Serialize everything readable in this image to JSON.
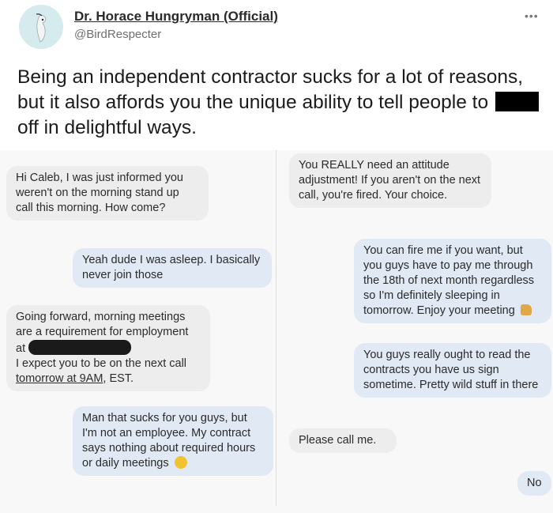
{
  "tweet": {
    "author_name": "Dr. Horace Hungryman (Official)",
    "handle": "@BirdRespecter",
    "more_label": "•••",
    "text_part1": "Being an independent contractor sucks for a lot of reasons, but it also affords you the unique ability to tell people to",
    "text_part2": "off in delightful ways."
  },
  "messages_left": [
    {
      "sender": "them",
      "text": "Hi Caleb, I was just informed you weren't on the morning stand up call this morning. How come?"
    },
    {
      "sender": "me",
      "text": "Yeah dude I was asleep. I basically never join those"
    },
    {
      "sender": "them",
      "text_a": "Going forward, morning meetings are a requirement for employment at",
      "text_b": "I expect you to be on the next call ",
      "text_c": "tomorrow at 9AM",
      "text_d": ", EST."
    },
    {
      "sender": "me",
      "text": "Man that sucks for you guys, but I'm not an employee. My contract says nothing about required hours or daily meetings"
    }
  ],
  "messages_right": [
    {
      "sender": "them",
      "text": "You REALLY need an attitude adjustment! If you aren't on the next call, you're fired. Your choice."
    },
    {
      "sender": "me",
      "text": "You can fire me if you want, but you guys have to pay me through the 18th of next month regardless so I'm definitely sleeping in tomorrow. Enjoy your meeting"
    },
    {
      "sender": "me",
      "text": "You guys really ought to read the contracts you have us sign sometime. Pretty wild stuff in there"
    },
    {
      "sender": "them",
      "text": "Please call me."
    },
    {
      "sender": "me",
      "text": "No"
    }
  ],
  "colors": {
    "incoming": "#ededed",
    "outgoing": "#e1e9f4"
  }
}
